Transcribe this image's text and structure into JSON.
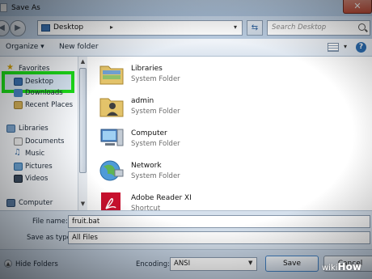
{
  "window": {
    "title": "Save As"
  },
  "address": {
    "location": "Desktop",
    "separator": "▸",
    "dropdown": "▾"
  },
  "search": {
    "placeholder": "Search Desktop"
  },
  "toolbar": {
    "organize": "Organize ▾",
    "new_folder": "New folder",
    "views_dropdown": "▾",
    "help": "?"
  },
  "nav": {
    "items": [
      {
        "label": "Favorites",
        "icon": "star-icon"
      },
      {
        "label": "Desktop",
        "icon": "desktop-icon"
      },
      {
        "label": "Downloads",
        "icon": "downloads-icon"
      },
      {
        "label": "Recent Places",
        "icon": "recent-places-icon"
      },
      {
        "label": "Libraries",
        "icon": "libraries-icon"
      },
      {
        "label": "Documents",
        "icon": "documents-icon"
      },
      {
        "label": "Music",
        "icon": "music-icon"
      },
      {
        "label": "Pictures",
        "icon": "pictures-icon"
      },
      {
        "label": "Videos",
        "icon": "videos-icon"
      },
      {
        "label": "Computer",
        "icon": "computer-icon"
      }
    ],
    "highlight_color": "#1ee01a"
  },
  "files": [
    {
      "name": "Libraries",
      "type": "System Folder",
      "icon": "libraries-folder-icon"
    },
    {
      "name": "admin",
      "type": "System Folder",
      "icon": "user-folder-icon"
    },
    {
      "name": "Computer",
      "type": "System Folder",
      "icon": "computer-icon"
    },
    {
      "name": "Network",
      "type": "System Folder",
      "icon": "network-icon"
    },
    {
      "name": "Adobe Reader XI",
      "type": "Shortcut",
      "icon": "adobe-reader-icon"
    }
  ],
  "form": {
    "file_name_label": "File name:",
    "file_name_value": "fruit.bat",
    "save_as_type_label": "Save as type:",
    "save_as_type_value": "All Files"
  },
  "footer": {
    "hide_folders": "Hide Folders",
    "encoding_label": "Encoding:",
    "encoding_value": "ANSI",
    "save": "Save",
    "cancel": "Cancel"
  },
  "watermark": {
    "prefix": "wiki",
    "brand": "How"
  }
}
